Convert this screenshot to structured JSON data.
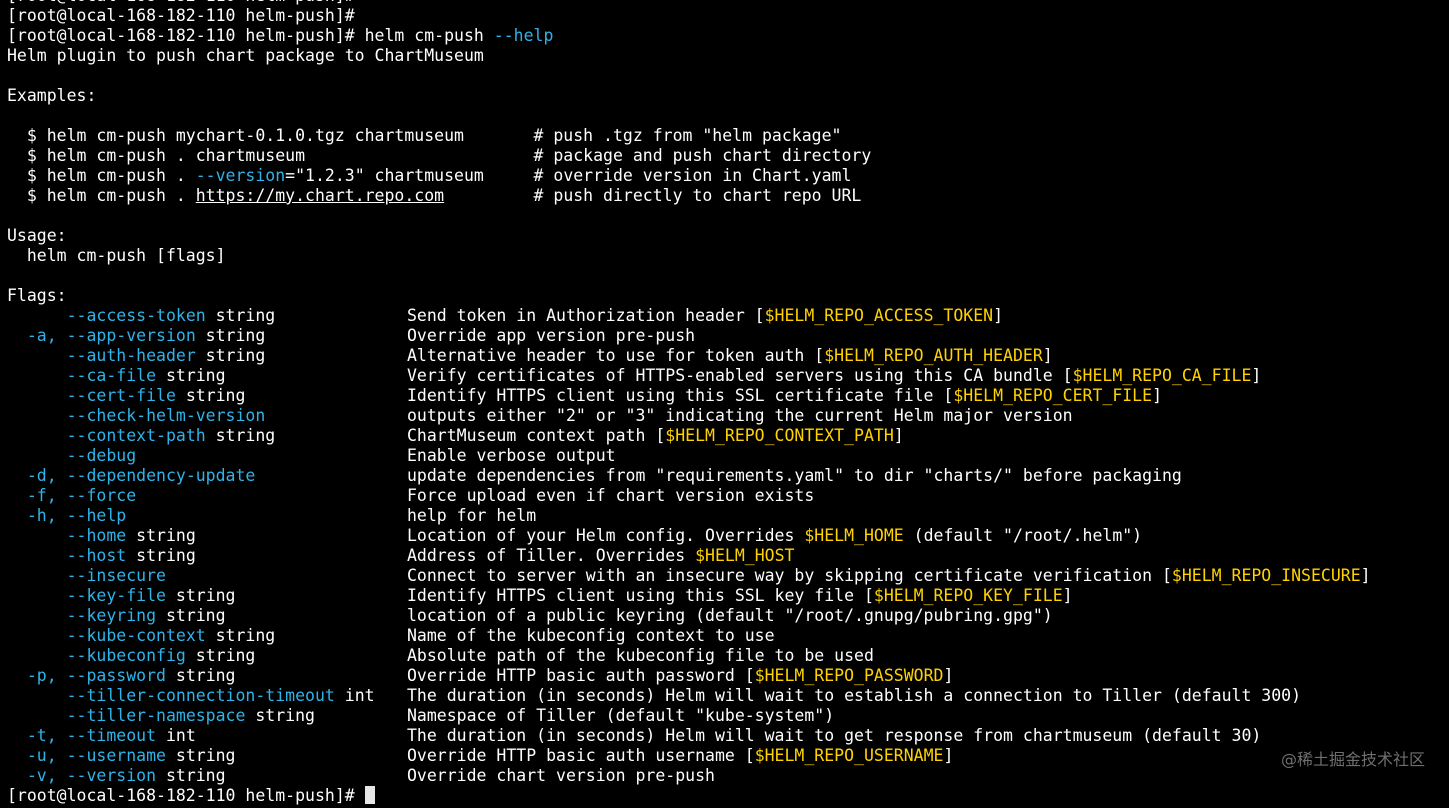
{
  "terminal": {
    "prompt": "[root@local-168-182-110 helm-push]#",
    "cmd_main": "helm cm-push",
    "cmd_flag": "--help",
    "description": "Helm plugin to push chart package to ChartMuseum",
    "examples_header": "Examples:",
    "examples": [
      {
        "pre": "  $ helm cm-push mychart-0.1.0.tgz chartmuseum       ",
        "comment": "# push .tgz from \"helm package\""
      },
      {
        "pre": "  $ helm cm-push . chartmuseum                       ",
        "comment": "# package and push chart directory"
      },
      {
        "pre_a": "  $ helm cm-push . ",
        "flag": "--version",
        "pre_b": "=\"1.2.3\" chartmuseum     ",
        "comment": "# override version in Chart.yaml"
      },
      {
        "pre_a": "  $ helm cm-push . ",
        "url": "https://my.chart.repo.com",
        "pre_b": "         ",
        "comment": "# push directly to chart repo URL"
      }
    ],
    "usage_header": "Usage:",
    "usage_line": "  helm cm-push [flags]",
    "flags_header": "Flags:",
    "flags": [
      {
        "short": "      ",
        "long": "--access-token",
        "type": " string",
        "desc": "Send token in Authorization header [",
        "env": "$HELM_REPO_ACCESS_TOKEN",
        "tail": "]"
      },
      {
        "short": "  -a, ",
        "long": "--app-version",
        "type": " string",
        "desc": "Override app version pre-push",
        "env": "",
        "tail": ""
      },
      {
        "short": "      ",
        "long": "--auth-header",
        "type": " string",
        "desc": "Alternative header to use for token auth [",
        "env": "$HELM_REPO_AUTH_HEADER",
        "tail": "]"
      },
      {
        "short": "      ",
        "long": "--ca-file",
        "type": " string",
        "desc": "Verify certificates of HTTPS-enabled servers using this CA bundle [",
        "env": "$HELM_REPO_CA_FILE",
        "tail": "]"
      },
      {
        "short": "      ",
        "long": "--cert-file",
        "type": " string",
        "desc": "Identify HTTPS client using this SSL certificate file [",
        "env": "$HELM_REPO_CERT_FILE",
        "tail": "]"
      },
      {
        "short": "      ",
        "long": "--check-helm-version",
        "type": "",
        "desc": "outputs either \"2\" or \"3\" indicating the current Helm major version",
        "env": "",
        "tail": ""
      },
      {
        "short": "      ",
        "long": "--context-path",
        "type": " string",
        "desc": "ChartMuseum context path [",
        "env": "$HELM_REPO_CONTEXT_PATH",
        "tail": "]"
      },
      {
        "short": "      ",
        "long": "--debug",
        "type": "",
        "desc": "Enable verbose output",
        "env": "",
        "tail": ""
      },
      {
        "short": "  -d, ",
        "long": "--dependency-update",
        "type": "",
        "desc": "update dependencies from \"requirements.yaml\" to dir \"charts/\" before packaging",
        "env": "",
        "tail": ""
      },
      {
        "short": "  -f, ",
        "long": "--force",
        "type": "",
        "desc": "Force upload even if chart version exists",
        "env": "",
        "tail": ""
      },
      {
        "short": "  -h, ",
        "long": "--help",
        "type": "",
        "desc": "help for helm",
        "env": "",
        "tail": ""
      },
      {
        "short": "      ",
        "long": "--home",
        "type": " string",
        "desc": "Location of your Helm config. Overrides ",
        "env": "$HELM_HOME",
        "tail": " (default \"/root/.helm\")"
      },
      {
        "short": "      ",
        "long": "--host",
        "type": " string",
        "desc": "Address of Tiller. Overrides ",
        "env": "$HELM_HOST",
        "tail": ""
      },
      {
        "short": "      ",
        "long": "--insecure",
        "type": "",
        "desc": "Connect to server with an insecure way by skipping certificate verification [",
        "env": "$HELM_REPO_INSECURE",
        "tail": "]"
      },
      {
        "short": "      ",
        "long": "--key-file",
        "type": " string",
        "desc": "Identify HTTPS client using this SSL key file [",
        "env": "$HELM_REPO_KEY_FILE",
        "tail": "]"
      },
      {
        "short": "      ",
        "long": "--keyring",
        "type": " string",
        "desc": "location of a public keyring (default \"/root/.gnupg/pubring.gpg\")",
        "env": "",
        "tail": ""
      },
      {
        "short": "      ",
        "long": "--kube-context",
        "type": " string",
        "desc": "Name of the kubeconfig context to use",
        "env": "",
        "tail": ""
      },
      {
        "short": "      ",
        "long": "--kubeconfig",
        "type": " string",
        "desc": "Absolute path of the kubeconfig file to be used",
        "env": "",
        "tail": ""
      },
      {
        "short": "  -p, ",
        "long": "--password",
        "type": " string",
        "desc": "Override HTTP basic auth password [",
        "env": "$HELM_REPO_PASSWORD",
        "tail": "]"
      },
      {
        "short": "      ",
        "long": "--tiller-connection-timeout",
        "type": " int",
        "desc": "The duration (in seconds) Helm will wait to establish a connection to Tiller (default 300)",
        "env": "",
        "tail": ""
      },
      {
        "short": "      ",
        "long": "--tiller-namespace",
        "type": " string",
        "desc": "Namespace of Tiller (default \"kube-system\")",
        "env": "",
        "tail": ""
      },
      {
        "short": "  -t, ",
        "long": "--timeout",
        "type": " int",
        "desc": "The duration (in seconds) Helm will wait to get response from chartmuseum (default 30)",
        "env": "",
        "tail": ""
      },
      {
        "short": "  -u, ",
        "long": "--username",
        "type": " string",
        "desc": "Override HTTP basic auth username [",
        "env": "$HELM_REPO_USERNAME",
        "tail": "]"
      },
      {
        "short": "  -v, ",
        "long": "--version",
        "type": " string",
        "desc": "Override chart version pre-push",
        "env": "",
        "tail": ""
      }
    ],
    "watermark": "@稀土掘金技术社区"
  },
  "colors": {
    "background": "#000000",
    "text": "#ffffff",
    "flag": "#2fb3e8",
    "env": "#ffd200"
  }
}
